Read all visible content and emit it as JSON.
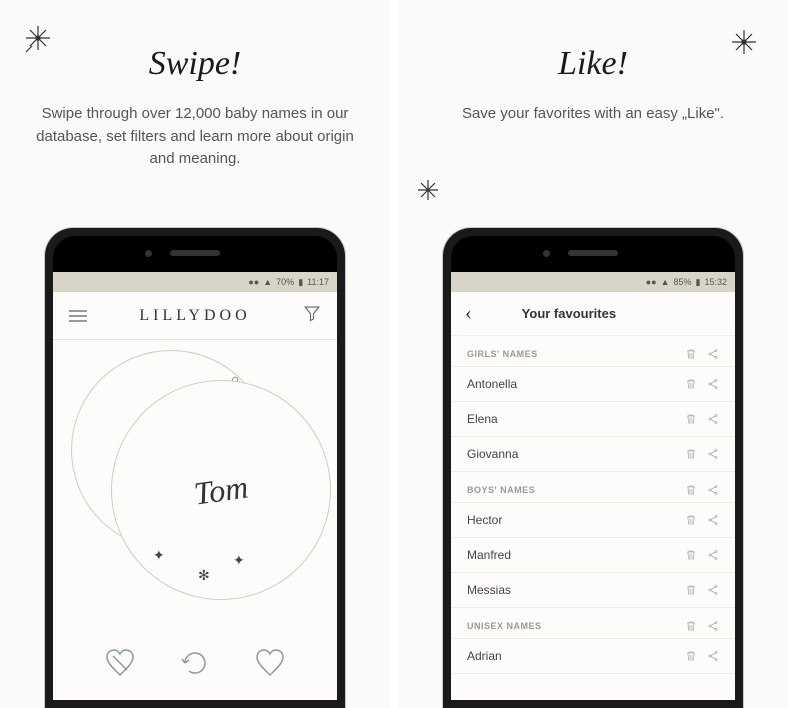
{
  "left": {
    "title": "Swipe!",
    "subtitle": "Swipe through over 12,000 baby names in our database, set filters and learn more about origin and meaning.",
    "appName": "LILLYDOO",
    "statusTime": "11:17",
    "statusBattery": "70%",
    "currentName": "Tom"
  },
  "right": {
    "title": "Like!",
    "subtitle": "Save your favorites with an easy „Like\".",
    "screenTitle": "Your favourites",
    "statusTime": "15:32",
    "statusBattery": "85%",
    "sections": [
      {
        "header": "GIRLS' NAMES",
        "items": [
          "Antonella",
          "Elena",
          "Giovanna"
        ]
      },
      {
        "header": "BOYS' NAMES",
        "items": [
          "Hector",
          "Manfred",
          "Messias"
        ]
      },
      {
        "header": "UNISEX NAMES",
        "items": [
          "Adrian"
        ]
      }
    ]
  }
}
